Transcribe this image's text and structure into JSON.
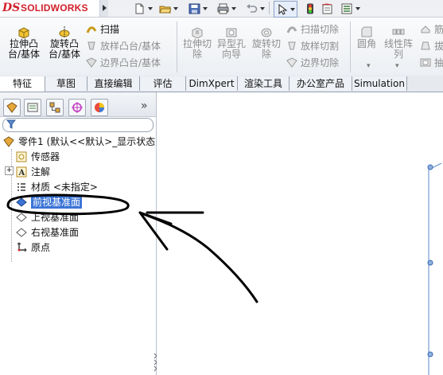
{
  "app": {
    "logo_prefix": "DS",
    "logo_text": "SOLIDWORKS"
  },
  "quick_access": {
    "icons": [
      "new-document-icon",
      "open-folder-icon",
      "save-icon",
      "print-icon",
      "undo-icon",
      "select-pointer-icon",
      "rebuild-traffic-light-icon",
      "file-properties-icon",
      "options-icon"
    ]
  },
  "ribbon": {
    "extrude_boss": "拉伸凸\n台/基体",
    "revolve_boss": "旋转凸\n台/基体",
    "sweep": "扫描",
    "loft_boss": "放样凸台/基体",
    "boundary_boss": "边界凸台/基体",
    "extrude_cut": "拉伸切\n除",
    "hole_wizard": "异型孔\n向导",
    "revolve_cut": "旋转切\n除",
    "swept_cut": "扫描切除",
    "lofted_cut": "放样切割",
    "boundary_cut": "边界切除",
    "fillet": "圆角",
    "linear_pattern": "线性阵\n列",
    "rib_partial": "筋",
    "draft_partial": "拔",
    "shell_partial": "抽"
  },
  "tabs": [
    "特征",
    "草图",
    "直接编辑",
    "评估",
    "DimXpert",
    "渲染工具",
    "办公室产品",
    "Simulation"
  ],
  "active_tab": "特征",
  "feature_tree": {
    "more_chevron": "»",
    "root": "零件1  (默认<<默认>_显示状态",
    "items": [
      {
        "label": "传感器",
        "icon": "sensors-icon"
      },
      {
        "label": "注解",
        "icon": "annotations-icon",
        "expander": "+"
      },
      {
        "label": "材质 <未指定>",
        "icon": "material-icon"
      },
      {
        "label": "前视基准面",
        "icon": "plane-icon",
        "selected": true
      },
      {
        "label": "上视基准面",
        "icon": "plane-icon"
      },
      {
        "label": "右视基准面",
        "icon": "plane-icon"
      },
      {
        "label": "原点",
        "icon": "origin-icon"
      }
    ]
  },
  "colors": {
    "brand_red": "#d0202a",
    "selection_bg": "#3a74d6",
    "annotation_ink": "#000000"
  }
}
